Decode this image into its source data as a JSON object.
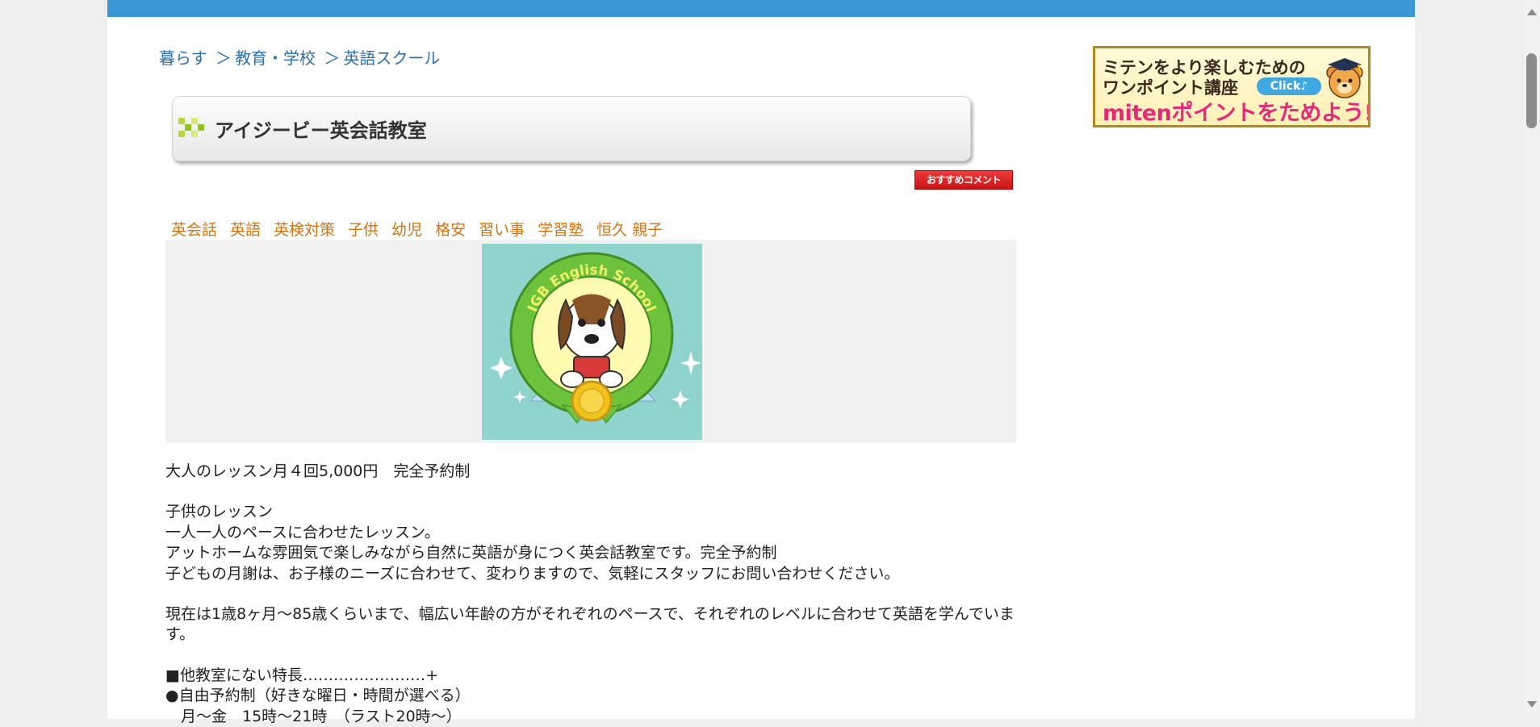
{
  "breadcrumb": {
    "items": [
      "暮らす",
      "教育・学校",
      "英語スクール"
    ],
    "separator": "＞"
  },
  "listing": {
    "title": "アイジービー英会話教室",
    "recommend_button": "おすすめコメント",
    "tags": [
      "英会話",
      "英語",
      "英検対策",
      "子供",
      "幼児",
      "格安",
      "習い事",
      "学習塾",
      "恒久 親子"
    ],
    "logo_text": "IGB English School",
    "body": [
      "大人のレッスン月４回5,000円　完全予約制",
      "",
      "子供のレッスン",
      "一人一人のペースに合わせたレッスン。",
      "アットホームな雰囲気で楽しみながら自然に英語が身につく英会話教室です。完全予約制",
      "子どもの月謝は、お子様のニーズに合わせて、変わりますので、気軽にスタッフにお問い合わせください。",
      "",
      "現在は1歳8ヶ月～85歳くらいまで、幅広い年齢の方がそれぞれのペースで、それぞれのレベルに合わせて英語を学んでいます。",
      "",
      "■他教室にない特長‥‥‥‥‥‥‥‥‥‥‥‥+",
      "●自由予約制（好きな曜日・時間が選べる）",
      "　月～金　15時～21時　（ラスト20時～）"
    ]
  },
  "banner": {
    "line1": "ミテンをより楽しむための",
    "line2": "ワンポイント講座",
    "line3": "mitenポイントをためよう!!",
    "click_label": "Click♪"
  },
  "colors": {
    "top_bar": "#3a97d4",
    "link": "#2a6fae",
    "tag": "#d4720c",
    "banner_accent": "#e8277c",
    "recommend_button": "#d42020"
  },
  "icons": {
    "title_mark": "green-checker-icon",
    "banner_mascot": "bear-graduate-icon",
    "scroll_up": "scroll-up-arrow-icon",
    "scroll_down": "scroll-down-arrow-icon"
  }
}
